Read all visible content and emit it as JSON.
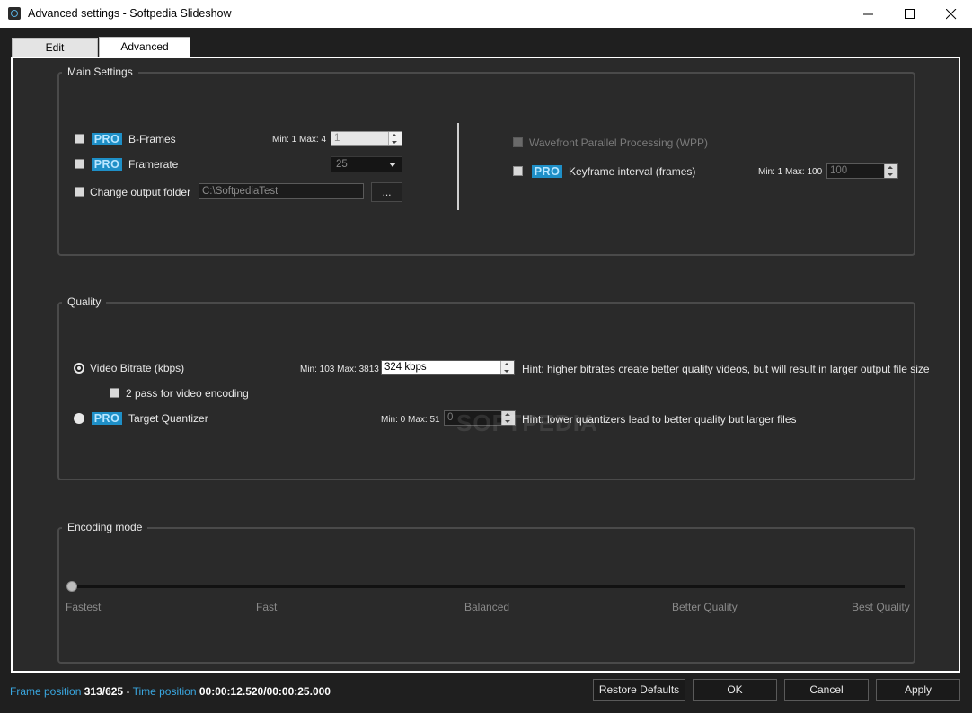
{
  "window": {
    "title": "Advanced settings - Softpedia Slideshow"
  },
  "tabs": [
    {
      "label": "Edit"
    },
    {
      "label": "Advanced"
    }
  ],
  "main_settings": {
    "title": "Main Settings",
    "bframes": {
      "badge": "PRO",
      "label": "B-Frames",
      "range": "Min: 1 Max: 4",
      "value": "1"
    },
    "framerate": {
      "badge": "PRO",
      "label": "Framerate",
      "value": "25"
    },
    "output_folder": {
      "label": "Change output folder",
      "value": "C:\\SoftpediaTest",
      "browse": "..."
    },
    "wpp": {
      "label": "Wavefront Parallel Processing (WPP)"
    },
    "keyframe": {
      "badge": "PRO",
      "label": "Keyframe interval (frames)",
      "range": "Min: 1 Max: 100",
      "value": "100"
    }
  },
  "quality": {
    "title": "Quality",
    "bitrate": {
      "label": "Video Bitrate (kbps)",
      "range": "Min: 103 Max: 3813",
      "value": "324 kbps",
      "hint": "Hint: higher bitrates create better quality videos, but will result in larger output file size"
    },
    "two_pass": {
      "label": "2 pass for video encoding"
    },
    "quantizer": {
      "badge": "PRO",
      "label": "Target Quantizer",
      "range": "Min: 0 Max: 51",
      "value": "0",
      "hint": "Hint: lower quantizers lead to better quality but larger files"
    }
  },
  "encoding": {
    "title": "Encoding mode",
    "stops": [
      "Fastest",
      "Fast",
      "Balanced",
      "Better Quality",
      "Best Quality"
    ],
    "selected": "Fastest"
  },
  "status": {
    "frame_label": "Frame position",
    "frame_value": "313/625",
    "separator": "-",
    "time_label": "Time position",
    "time_value": "00:00:12.520/00:00:25.000"
  },
  "buttons": {
    "restore": "Restore Defaults",
    "ok": "OK",
    "cancel": "Cancel",
    "apply": "Apply"
  },
  "watermark": "SOFTPEDIA",
  "colors": {
    "accent": "#1e8fc7",
    "status_blue": "#3aa7e0",
    "background": "#2a2a2a"
  }
}
